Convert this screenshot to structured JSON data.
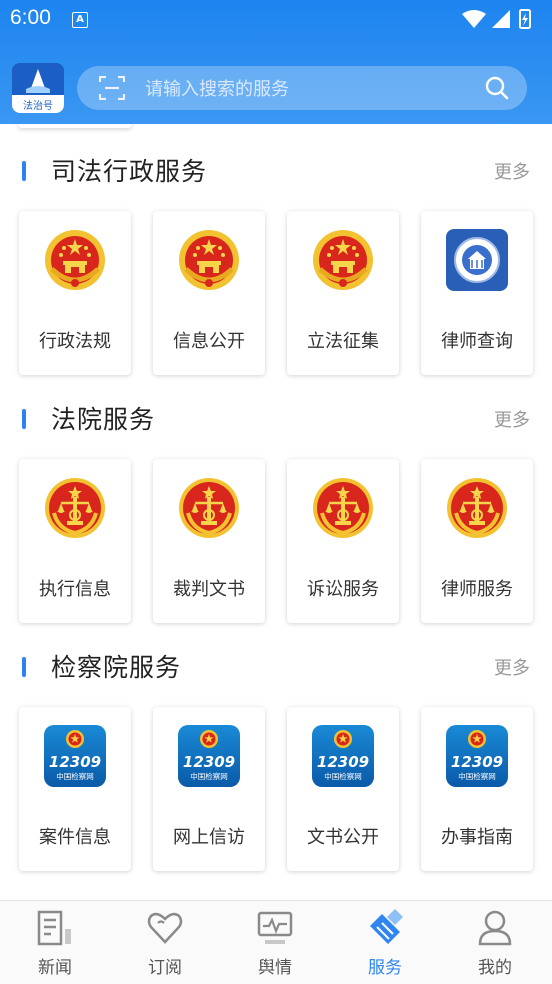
{
  "status_bar": {
    "time": "6:00",
    "notification_badge": "A"
  },
  "header": {
    "logo_text": "法治号"
  },
  "search": {
    "placeholder": "请输入搜索的服务"
  },
  "sections": [
    {
      "title": "司法行政服务",
      "more": "更多",
      "items": [
        {
          "label": "行政法规",
          "icon": "national-emblem-icon"
        },
        {
          "label": "信息公开",
          "icon": "national-emblem-icon"
        },
        {
          "label": "立法征集",
          "icon": "national-emblem-icon"
        },
        {
          "label": "律师查询",
          "icon": "lawyers-association-icon"
        }
      ]
    },
    {
      "title": "法院服务",
      "more": "更多",
      "items": [
        {
          "label": "执行信息",
          "icon": "court-emblem-icon"
        },
        {
          "label": "裁判文书",
          "icon": "court-emblem-icon"
        },
        {
          "label": "诉讼服务",
          "icon": "court-emblem-icon"
        },
        {
          "label": "律师服务",
          "icon": "court-emblem-icon"
        }
      ]
    },
    {
      "title": "检察院服务",
      "more": "更多",
      "items": [
        {
          "label": "案件信息",
          "icon": "procuratorate-12309-icon"
        },
        {
          "label": "网上信访",
          "icon": "procuratorate-12309-icon"
        },
        {
          "label": "文书公开",
          "icon": "procuratorate-12309-icon"
        },
        {
          "label": "办事指南",
          "icon": "procuratorate-12309-icon"
        }
      ]
    }
  ],
  "procuratorate_badge": {
    "number": "12309",
    "caption": "中国检察网"
  },
  "tabbar": [
    {
      "label": "新闻",
      "icon": "news-icon"
    },
    {
      "label": "订阅",
      "icon": "heart-icon"
    },
    {
      "label": "舆情",
      "icon": "monitor-icon"
    },
    {
      "label": "服务",
      "icon": "service-icon",
      "active": true
    },
    {
      "label": "我的",
      "icon": "profile-icon"
    }
  ],
  "colors": {
    "accent": "#2f86f0",
    "header": "#1d84f0",
    "emblem_red": "#d9261c",
    "emblem_gold": "#f2c230"
  }
}
